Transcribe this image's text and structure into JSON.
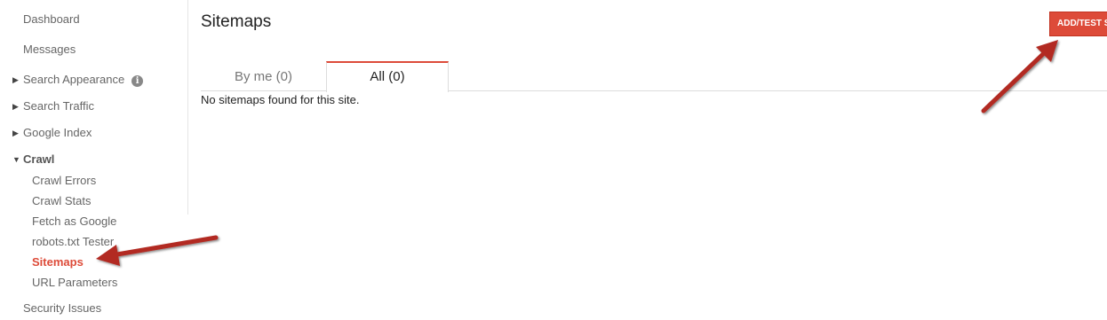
{
  "sidebar": {
    "dashboard": "Dashboard",
    "messages": "Messages",
    "search_appearance": "Search Appearance",
    "search_traffic": "Search Traffic",
    "google_index": "Google Index",
    "crawl": "Crawl",
    "crawl_items": [
      {
        "label": "Crawl Errors"
      },
      {
        "label": "Crawl Stats"
      },
      {
        "label": "Fetch as Google"
      },
      {
        "label": "robots.txt Tester"
      },
      {
        "label": "Sitemaps",
        "active": true
      },
      {
        "label": "URL Parameters"
      }
    ],
    "security_issues": "Security Issues",
    "info_icon": "i"
  },
  "main": {
    "title": "Sitemaps",
    "add_button": "ADD/TEST SITEMAP",
    "tabs": [
      {
        "label": "By me (0)",
        "active": false
      },
      {
        "label": "All (0)",
        "active": true
      }
    ],
    "empty_message": "No sitemaps found for this site."
  },
  "colors": {
    "accent": "#dd4b39",
    "annotation_arrow": "#b22a22"
  }
}
